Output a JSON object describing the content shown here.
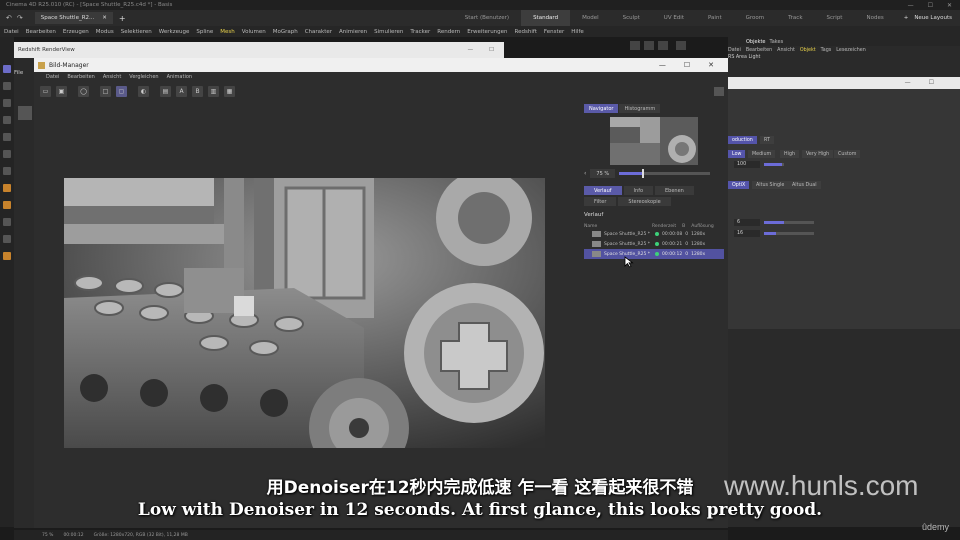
{
  "os_title": "Cinema 4D R25.010 (RC) - [Space Shuttle_R25.c4d *] - Basis",
  "window_controls": [
    "—",
    "☐",
    "✕"
  ],
  "doc_tab": "Space Shuttle_R2...",
  "layout_tabs": [
    "Start (Benutzer)",
    "Standard",
    "Model",
    "Sculpt",
    "UV Edit",
    "Paint",
    "Groom",
    "Track",
    "Script",
    "Nodes"
  ],
  "active_layout": "Standard",
  "new_layouts": "Neue Layouts",
  "main_menu": [
    "Datei",
    "Bearbeiten",
    "Erzeugen",
    "Modus",
    "Selektieren",
    "Werkzeuge",
    "Spline",
    "Mesh",
    "Volumen",
    "MoGraph",
    "Charakter",
    "Animieren",
    "Simulieren",
    "Tracker",
    "Rendern",
    "Erweiterungen",
    "Redshift",
    "Fenster",
    "Hilfe"
  ],
  "redshift_window_title": "Redshift RenderView",
  "redshift_file": "File",
  "bild_manager": {
    "title": "Bild-Manager",
    "menu": [
      "Datei",
      "Bearbeiten",
      "Ansicht",
      "Vergleichen",
      "Animation"
    ],
    "toolbar_text": [
      "A",
      "B"
    ],
    "side_tabs": [
      "Navigator",
      "Histogramm"
    ],
    "zoom": "75 %",
    "zoom_fraction": 0.25,
    "tabs2": [
      "Verlauf",
      "Info",
      "Ebenen",
      "Filter",
      "Stereoskopie"
    ],
    "section": "Verlauf",
    "columns": [
      "Name",
      "Renderzeit",
      "B",
      "Auflösung"
    ],
    "history": [
      {
        "name": "Space Shuttle_R25 *",
        "time": "00:00:08",
        "b": "0",
        "res": "1280x"
      },
      {
        "name": "Space Shuttle_R25 *",
        "time": "00:00:21",
        "b": "0",
        "res": "1280x"
      },
      {
        "name": "Space Shuttle_R25 *",
        "time": "00:00:12",
        "b": "0",
        "res": "1280x"
      }
    ]
  },
  "objects_panel": {
    "tabs": [
      "Objekte",
      "Takes"
    ],
    "menu": [
      "Datei",
      "Bearbeiten",
      "Ansicht",
      "Objekt",
      "Tags",
      "Lesezeichen"
    ],
    "item": "RS Area Light"
  },
  "render_settings": {
    "production": "oduction",
    "rt": "RT",
    "quality": [
      "Low",
      "Medium",
      "High",
      "Very High",
      "Custom"
    ],
    "value1": "100",
    "denoisers": [
      "OptiX",
      "Altus Single",
      "Altus Dual"
    ],
    "value2": "6",
    "value3": "16"
  },
  "status": [
    "75 %",
    "00:00:12",
    "Größe: 1280x720, RGB (32 Bit), 11,28 MB"
  ],
  "subtitle_cn": "用Denoiser在12秒内完成低速 乍一看 这看起来很不错",
  "subtitle_en": "Low with Denoiser in 12 seconds. At first glance, this looks pretty good.",
  "watermark": "www.hunls.com",
  "udemy": "ûdemy"
}
